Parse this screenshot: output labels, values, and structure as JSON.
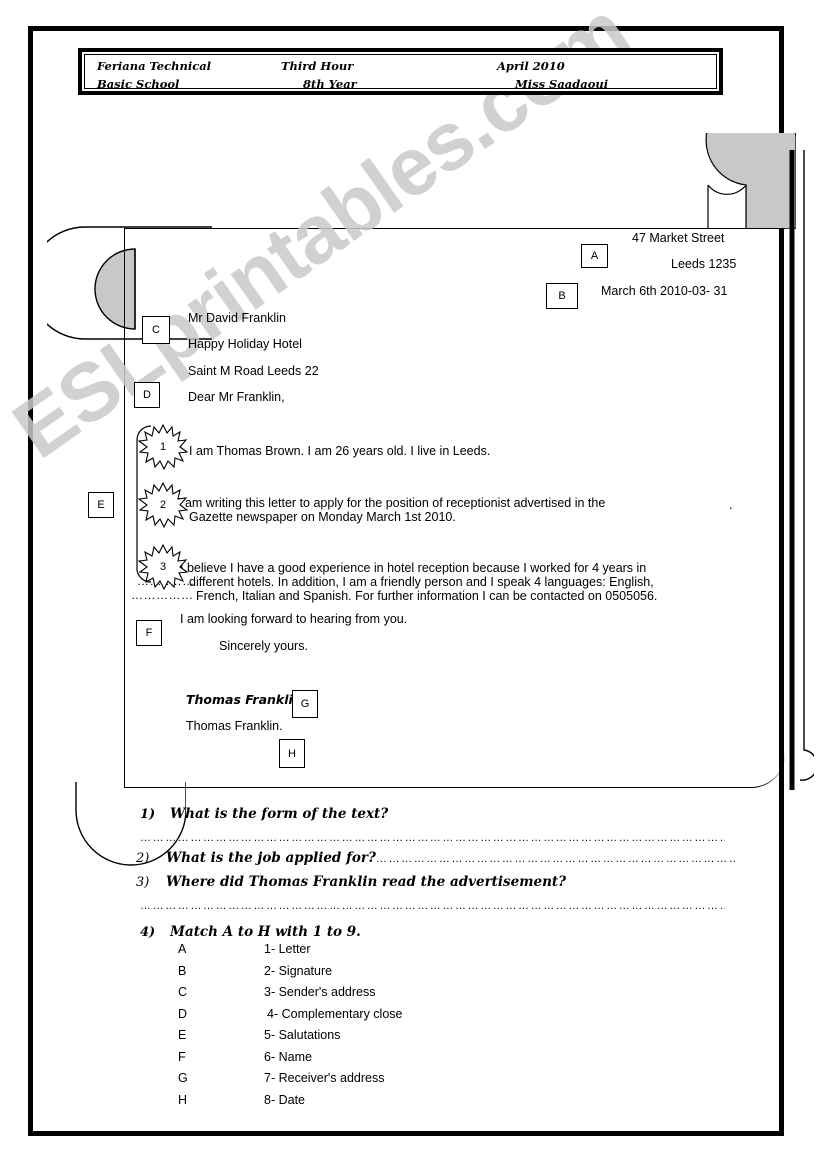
{
  "header": {
    "school_line1": "Feriana Technical",
    "school_line2": "Basic School",
    "session_line1": "Third Hour",
    "session_line2": "8th Year",
    "date_line1": "April 2010",
    "teacher_line2": "Miss Saadaoui"
  },
  "letter": {
    "sender_address": {
      "street": "47 Market Street",
      "city_code": "Leeds 1235",
      "date": "March 6th 2010-03- 31"
    },
    "recipient": {
      "name": "Mr David Franklin",
      "organisation": "Happy Holiday Hotel",
      "address": "Saint M Road      Leeds 22"
    },
    "salutation": "Dear Mr Franklin,",
    "paragraphs": [
      {
        "number": "1",
        "lines": [
          "I am Thomas Brown. I am 26 years old. I live in Leeds."
        ]
      },
      {
        "number": "2",
        "lines": [
          "I am writing this letter to apply for the position of receptionist advertised in the",
          "Gazette newspaper on Monday March 1st 2010."
        ]
      },
      {
        "number": "3",
        "lines": [
          "I believe I have a good experience in hotel reception because I worked for 4 years in",
          "different hotels. In addition, I am a friendly person and I speak 4 languages: English,",
          "French, Italian and Spanish. For further information I can be contacted on 0505056."
        ]
      }
    ],
    "closing_line": "I am looking forward to hearing from you.",
    "complementary_close": "Sincerely yours.",
    "signature": "Thomas Franklin.",
    "typed_name": "Thomas Franklin.",
    "stray_dot": ".",
    "leader_dots_1": "……..……",
    "leader_dots_2": "……………"
  },
  "markers": {
    "a": "A",
    "b": "B",
    "c": "C",
    "d": "D",
    "e": "E",
    "f": "F",
    "g": "G",
    "h": "H"
  },
  "questions": [
    {
      "number": "1)",
      "text": "What is the form of the text?"
    },
    {
      "number": "2)",
      "text": "What is the job applied for?"
    },
    {
      "number": "3)",
      "text": "Where did Thomas Franklin read the advertisement?"
    },
    {
      "number": "4)",
      "text": "Match A to H with 1 to 9."
    }
  ],
  "answer_dots": "………………………………………………………………………………………………………………………………………………………………………………………………………………",
  "inline_dots_q2": "……………………………………………………………………………………………………",
  "match": {
    "letters": [
      "A",
      "B",
      "C",
      "D",
      "E",
      "F",
      "G",
      "H"
    ],
    "items": [
      "1- Letter",
      "2- Signature",
      "3- Sender's address",
      "4- Complementary close",
      "5- Salutations",
      "6- Name",
      "7- Receiver's address",
      "8- Date"
    ]
  },
  "watermark": {
    "text": "ESLprintables.com"
  },
  "colors": {
    "ink": "#000000",
    "paper": "#ffffff",
    "deco_fill": "#c8c8c8",
    "watermark": "#c9c9c9"
  }
}
